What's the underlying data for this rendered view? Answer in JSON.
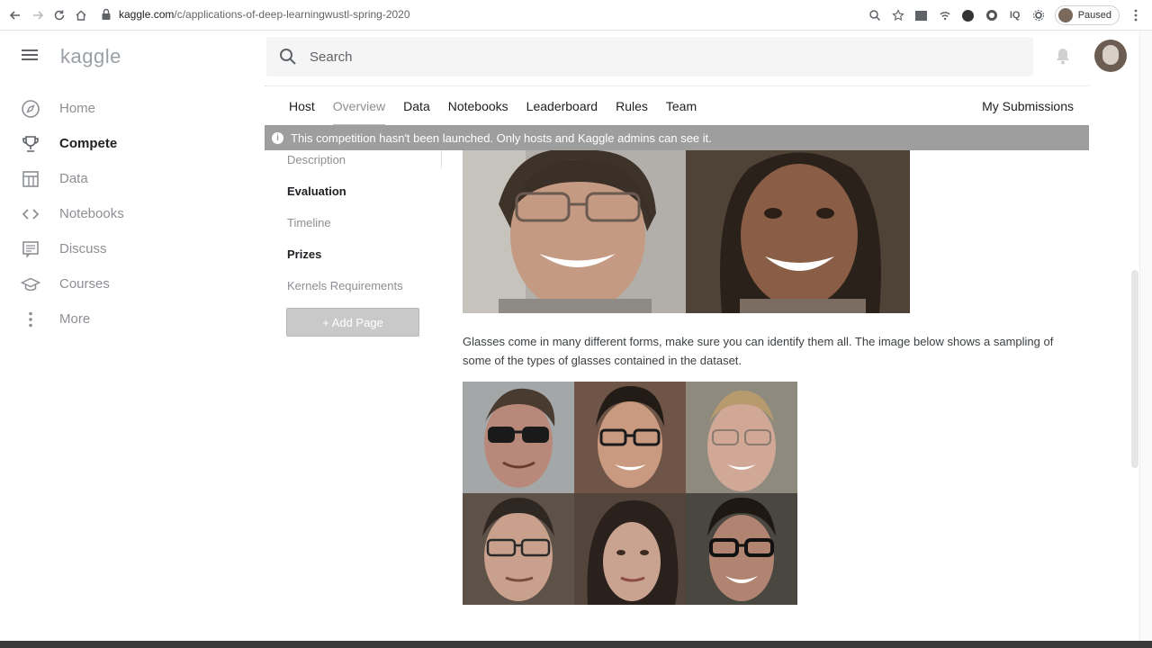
{
  "browser": {
    "url_host": "kaggle.com",
    "url_path": "/c/applications-of-deep-learningwustl-spring-2020",
    "profile_status": "Paused",
    "extensions": [
      "IQ"
    ]
  },
  "header": {
    "logo": "kaggle",
    "search_placeholder": "Search"
  },
  "sidebar": {
    "items": [
      {
        "label": "Home",
        "icon": "compass-icon"
      },
      {
        "label": "Compete",
        "icon": "trophy-icon",
        "active": true
      },
      {
        "label": "Data",
        "icon": "table-icon"
      },
      {
        "label": "Notebooks",
        "icon": "code-icon"
      },
      {
        "label": "Discuss",
        "icon": "comments-icon"
      },
      {
        "label": "Courses",
        "icon": "graduation-cap-icon"
      },
      {
        "label": "More",
        "icon": "more-vertical-icon"
      }
    ]
  },
  "competition_nav": {
    "tabs": [
      "Host",
      "Overview",
      "Data",
      "Notebooks",
      "Leaderboard",
      "Rules",
      "Team"
    ],
    "selected": "Overview",
    "my_submissions": "My Submissions"
  },
  "banner": {
    "text": "This competition hasn't been launched. Only hosts and Kaggle admins can see it."
  },
  "page_nav": {
    "items": [
      "Description",
      "Evaluation",
      "Timeline",
      "Prizes",
      "Kernels Requirements"
    ],
    "add_page": "+ Add Page"
  },
  "content": {
    "paragraph": "Glasses come in many different forms, make sure you can identify them all. The image below shows a sampling of some of the types of glasses contained in the dataset."
  },
  "colors": {
    "banner_bg": "#9e9e9e",
    "search_bg": "#f5f5f5",
    "muted_text": "#8c8f93"
  }
}
